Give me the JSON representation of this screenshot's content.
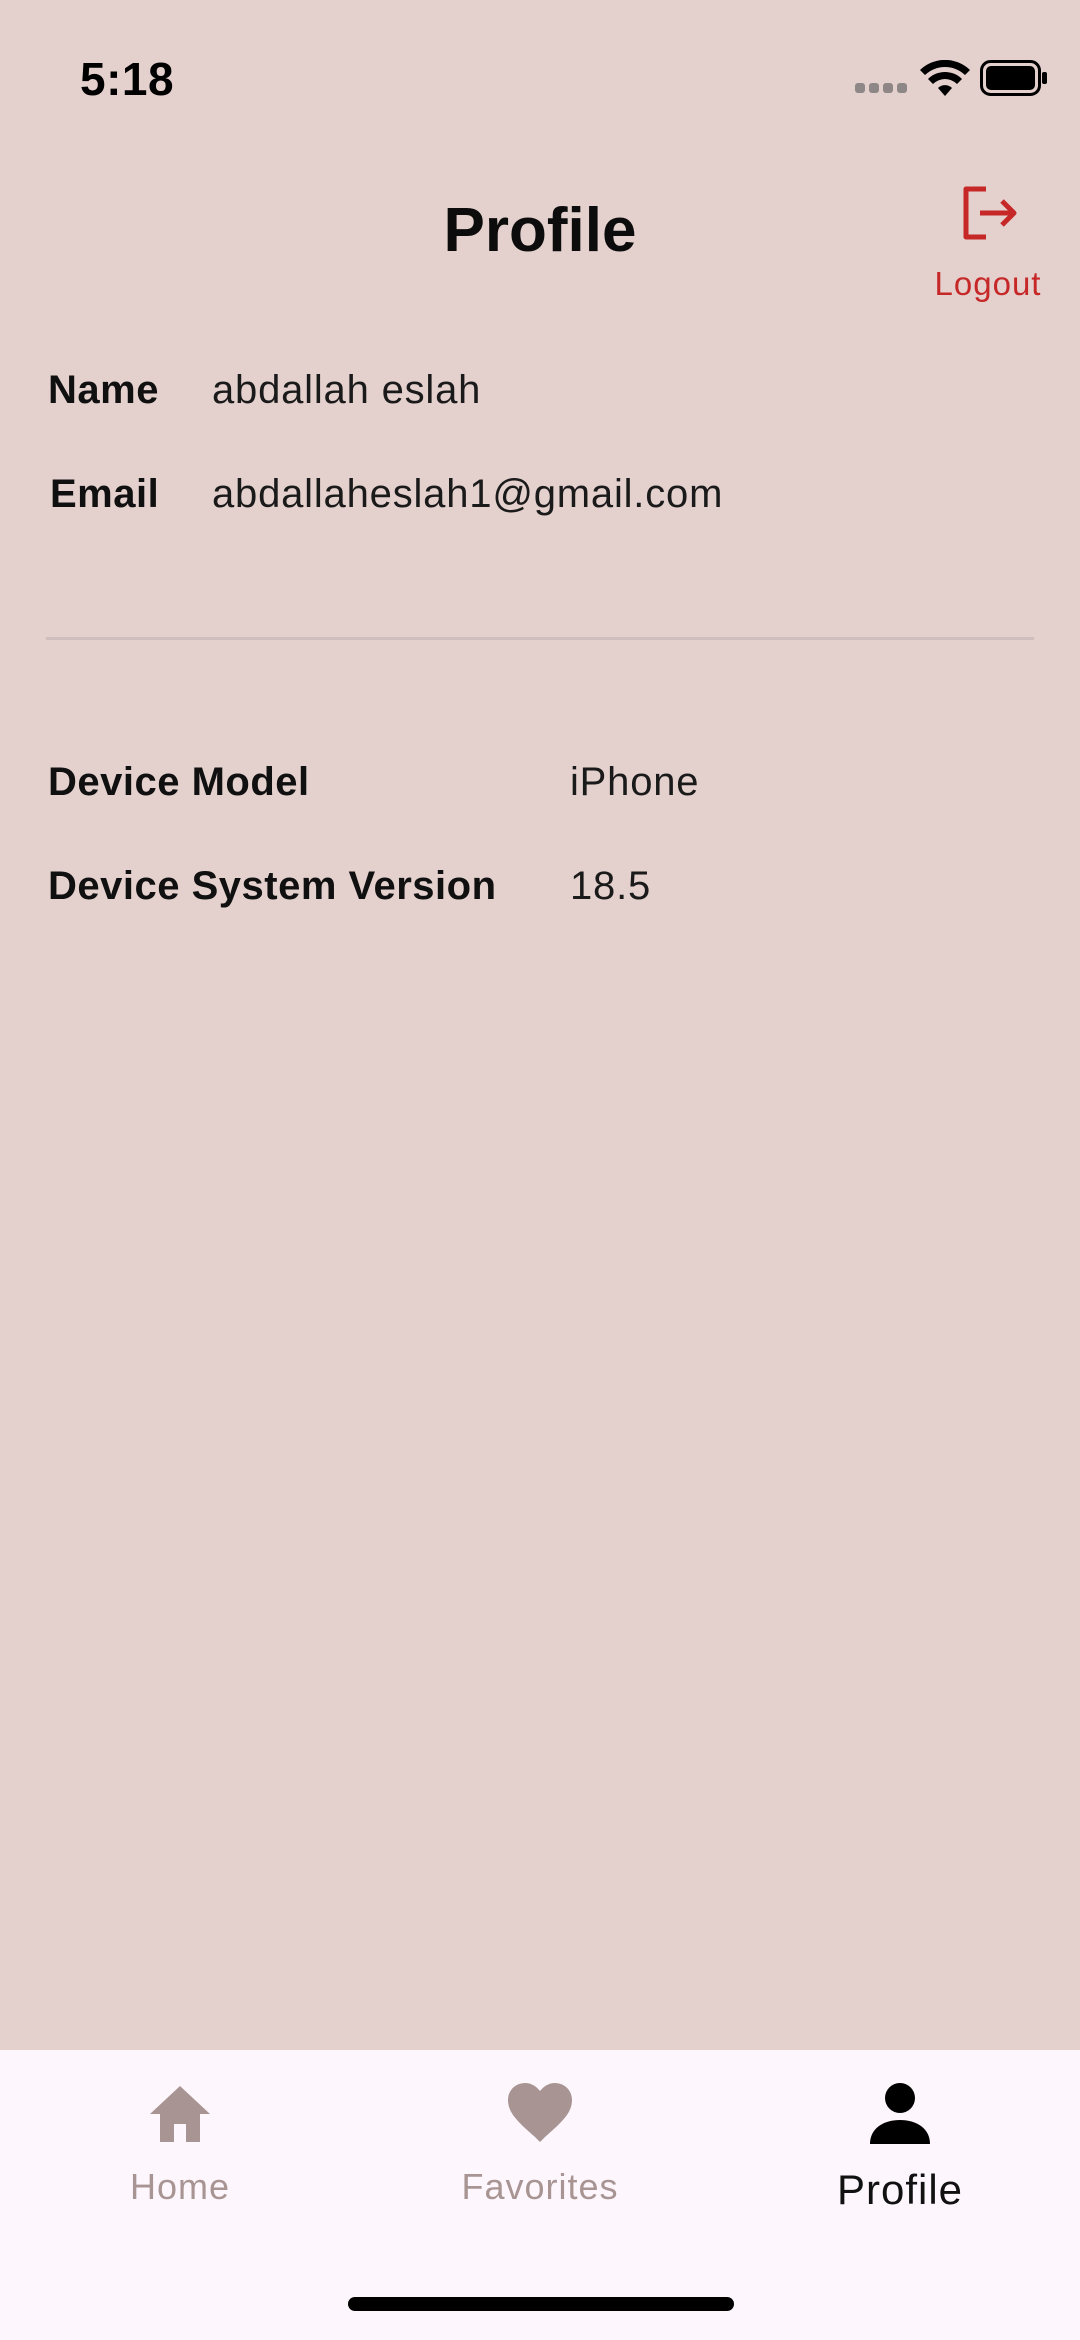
{
  "status_bar": {
    "time": "5:18"
  },
  "header": {
    "title": "Profile",
    "logout_label": "Logout"
  },
  "user": {
    "name_label": "Name",
    "name_value": "abdallah eslah",
    "email_label": "Email",
    "email_value": "abdallaheslah1@gmail.com"
  },
  "device": {
    "model_label": "Device Model",
    "model_value": "iPhone",
    "version_label": "Device System Version",
    "version_value": "18.5"
  },
  "nav": {
    "items": [
      {
        "label": "Home",
        "icon": "home-icon",
        "active": false
      },
      {
        "label": "Favorites",
        "icon": "heart-icon",
        "active": false
      },
      {
        "label": "Profile",
        "icon": "person-icon",
        "active": true
      }
    ]
  },
  "colors": {
    "background": "#e4d1ce",
    "accent_red": "#c62828",
    "nav_background": "#fdf6fd",
    "nav_inactive": "#a89593"
  }
}
